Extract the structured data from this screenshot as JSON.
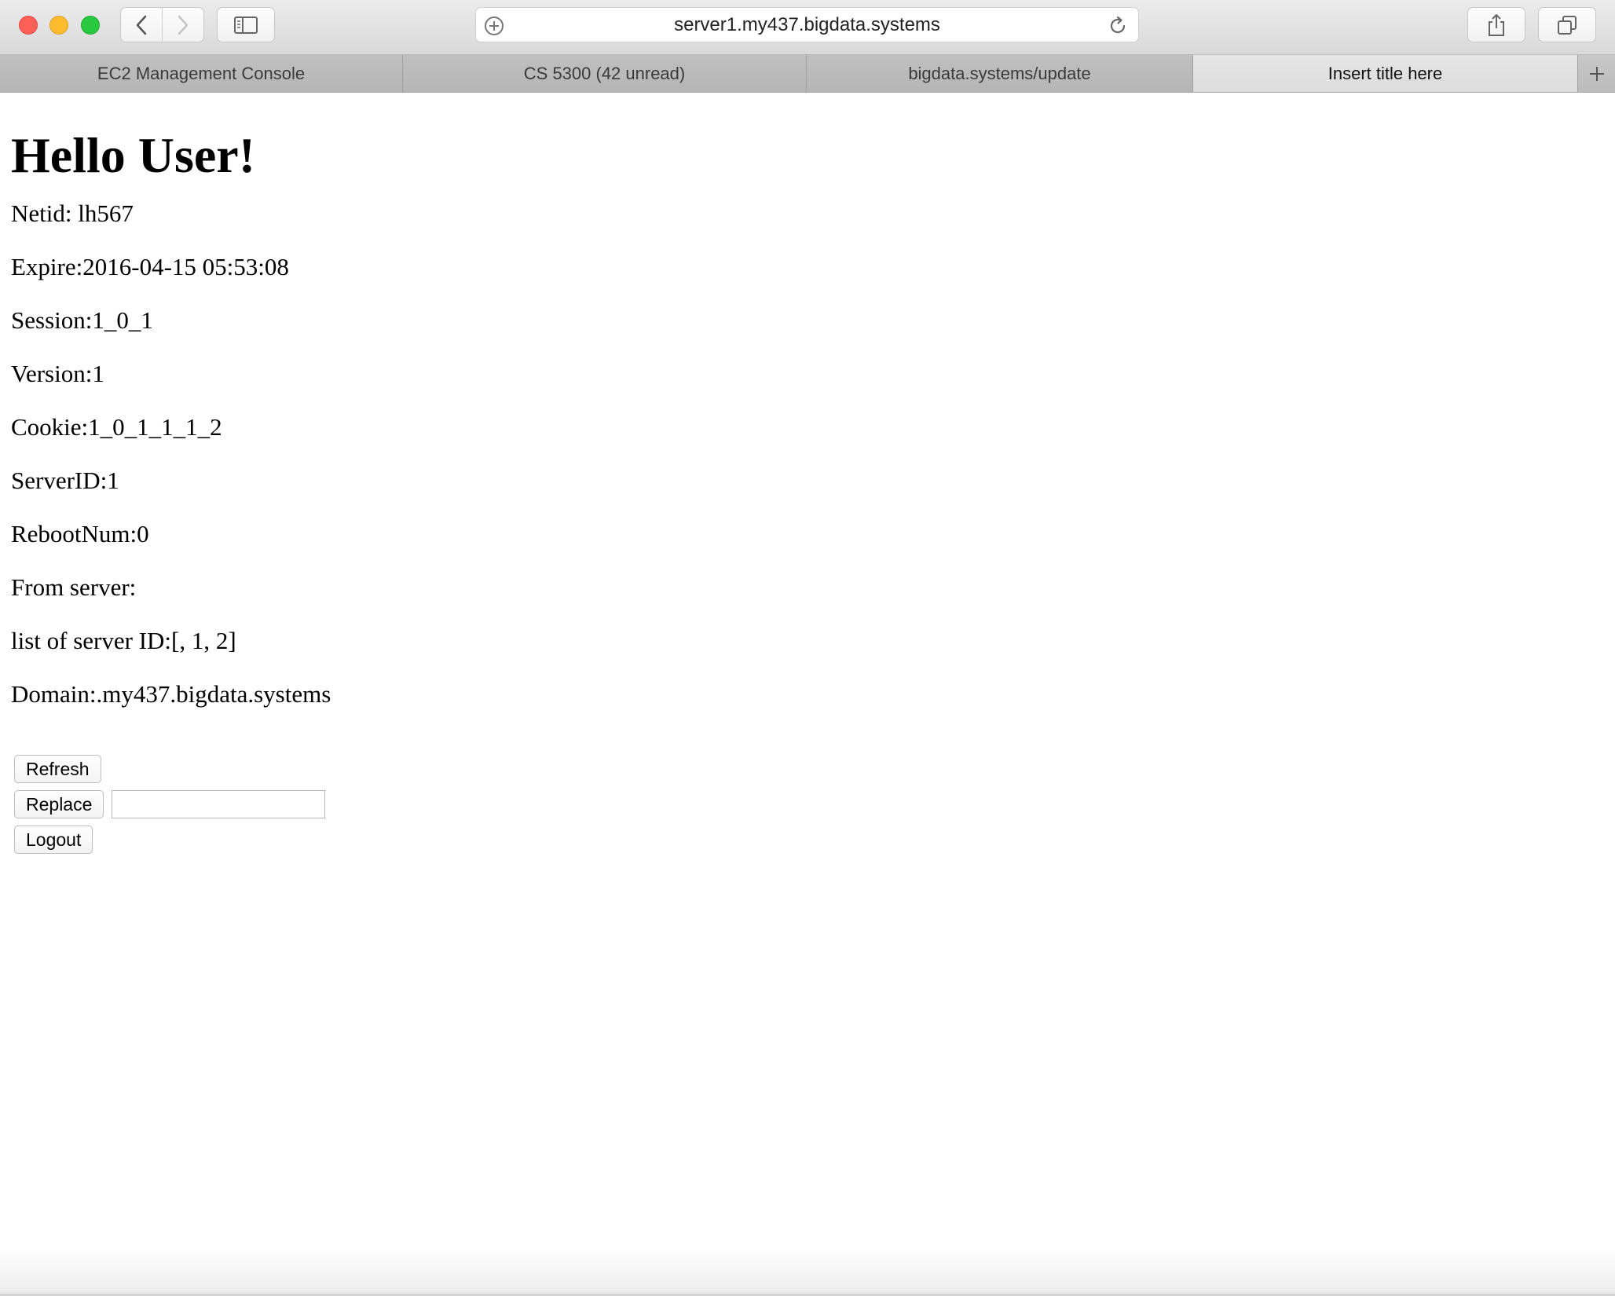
{
  "browser": {
    "url": "server1.my437.bigdata.systems",
    "icons": {
      "close": "close-icon",
      "minimize": "minimize-icon",
      "zoom": "zoom-icon",
      "back": "chevron-left-icon",
      "forward": "chevron-right-icon",
      "sidebar": "sidebar-icon",
      "add_bookmark": "plus-circle-icon",
      "reload": "reload-icon",
      "share": "share-icon",
      "tabs_overview": "tabs-icon",
      "new_tab": "plus-icon"
    },
    "tabs": [
      {
        "label": "EC2 Management Console",
        "active": false
      },
      {
        "label": "CS 5300 (42 unread)",
        "active": false
      },
      {
        "label": "bigdata.systems/update",
        "active": false
      },
      {
        "label": "Insert title here",
        "active": true
      }
    ]
  },
  "page": {
    "heading": "Hello User!",
    "fields": {
      "netid": "Netid: lh567",
      "expire": "Expire:2016-04-15 05:53:08",
      "session": "Session:1_0_1",
      "version": "Version:1",
      "cookie": "Cookie:1_0_1_1_1_2",
      "server_id": "ServerID:1",
      "reboot_num": "RebootNum:0",
      "from_server": "From server:",
      "server_list": "list of server ID:[, 1, 2]",
      "domain": "Domain:.my437.bigdata.systems"
    },
    "buttons": {
      "refresh": "Refresh",
      "replace": "Replace",
      "logout": "Logout"
    },
    "replace_input": {
      "value": "",
      "placeholder": ""
    }
  }
}
